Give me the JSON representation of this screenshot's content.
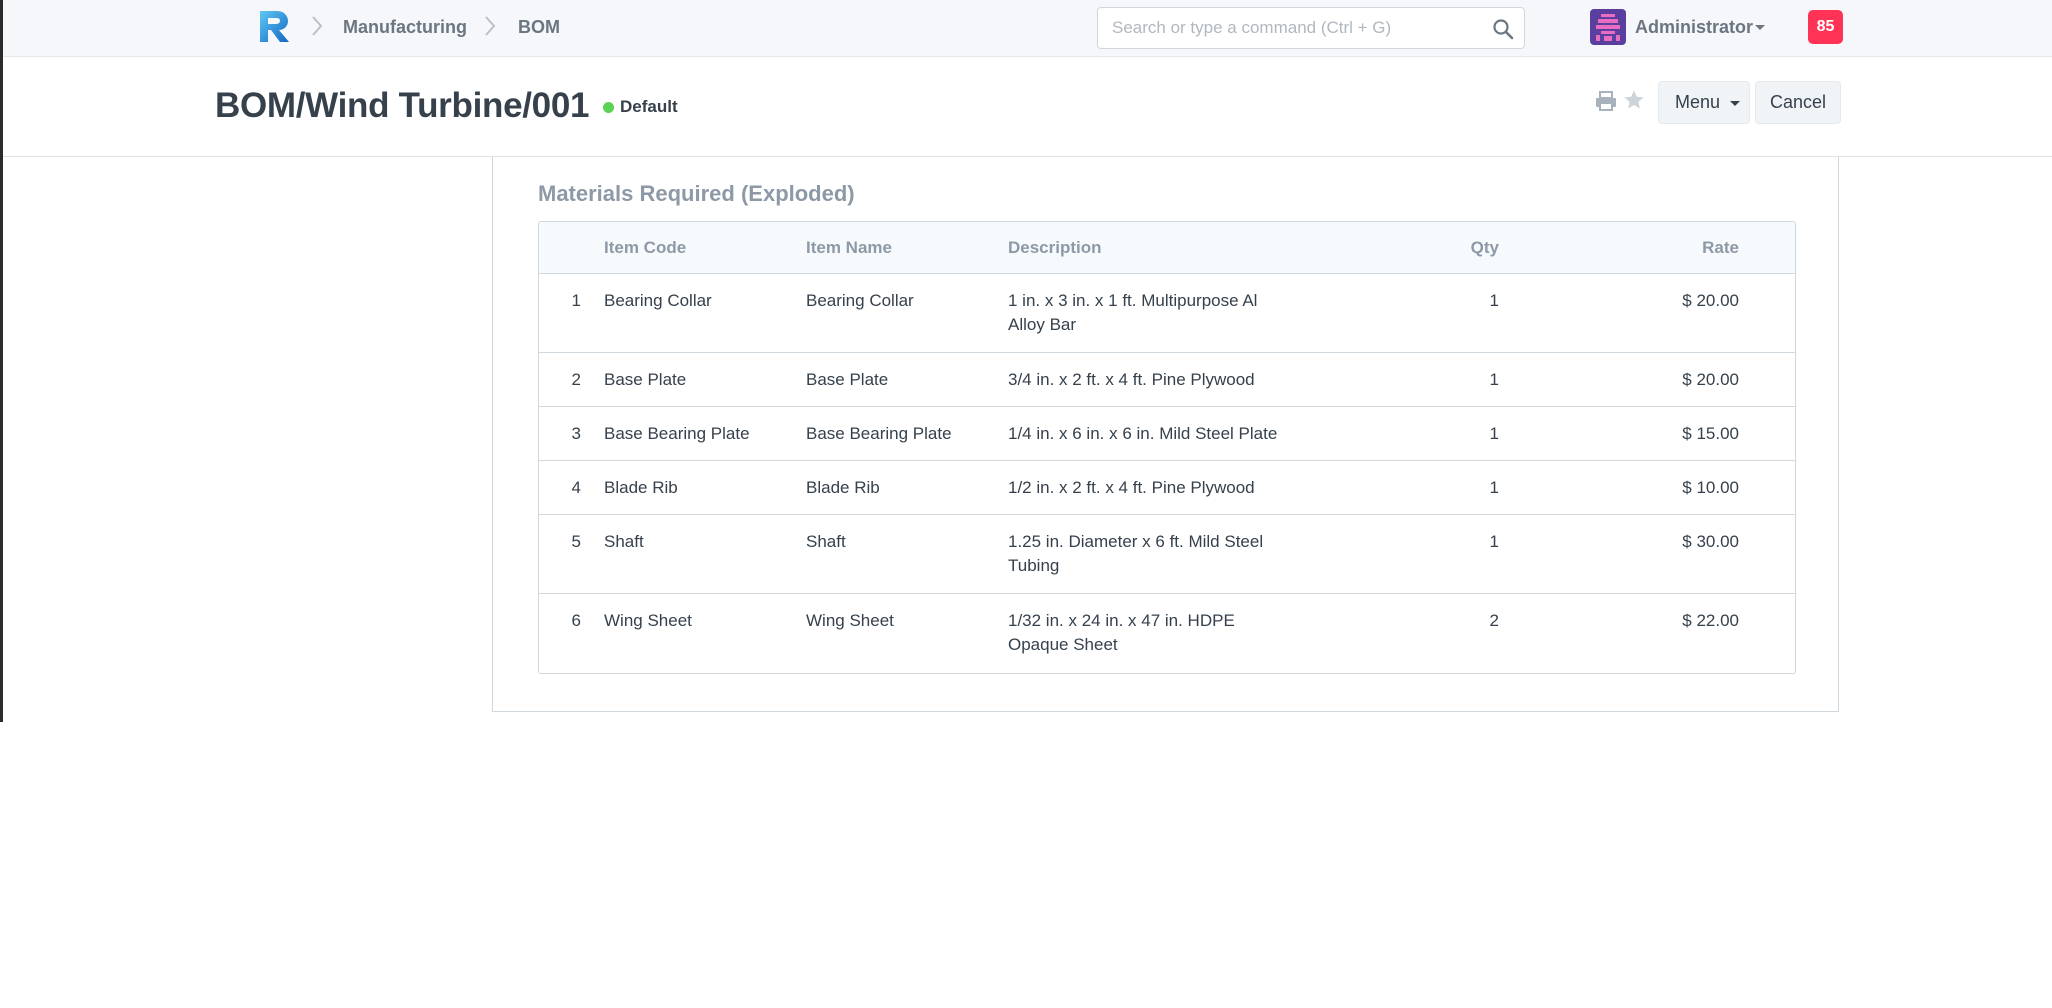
{
  "navbar": {
    "breadcrumbs": [
      "Manufacturing",
      "BOM"
    ],
    "search_placeholder": "Search or type a command (Ctrl + G)",
    "user_name": "Administrator",
    "notification_count": "85"
  },
  "page": {
    "title": "BOM/Wind Turbine/001",
    "status": "Default",
    "status_color": "#5cd154",
    "menu_label": "Menu",
    "cancel_label": "Cancel"
  },
  "section": {
    "title": "Materials Required (Exploded)",
    "columns": [
      "Item Code",
      "Item Name",
      "Description",
      "Qty",
      "Rate"
    ],
    "rows": [
      {
        "idx": "1",
        "item_code": "Bearing Collar",
        "item_name": "Bearing Collar",
        "description": "1 in. x 3 in. x 1 ft. Multipurpose Al Alloy Bar",
        "qty": "1",
        "rate": "$ 20.00"
      },
      {
        "idx": "2",
        "item_code": "Base Plate",
        "item_name": "Base Plate",
        "description": "3/4 in. x 2 ft. x 4 ft. Pine Plywood",
        "qty": "1",
        "rate": "$ 20.00"
      },
      {
        "idx": "3",
        "item_code": "Base Bearing Plate",
        "item_name": "Base Bearing Plate",
        "description": "1/4 in. x 6 in. x 6 in. Mild Steel Plate",
        "qty": "1",
        "rate": "$ 15.00"
      },
      {
        "idx": "4",
        "item_code": "Blade Rib",
        "item_name": "Blade Rib",
        "description": "1/2 in. x 2 ft. x 4 ft. Pine Plywood",
        "qty": "1",
        "rate": "$ 10.00"
      },
      {
        "idx": "5",
        "item_code": "Shaft",
        "item_name": "Shaft",
        "description": "1.25 in. Diameter x 6 ft. Mild Steel Tubing",
        "qty": "1",
        "rate": "$ 30.00"
      },
      {
        "idx": "6",
        "item_code": "Wing Sheet",
        "item_name": "Wing Sheet",
        "description": "1/32 in. x 24 in. x 47 in. HDPE Opaque Sheet",
        "qty": "2",
        "rate": "$ 22.00"
      }
    ]
  }
}
